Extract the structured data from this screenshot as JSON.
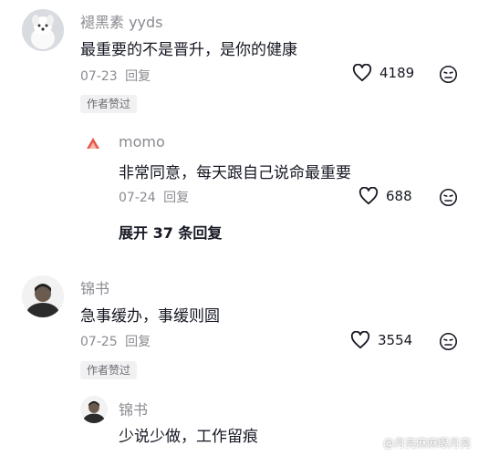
{
  "comments": [
    {
      "username": "褪黑素 yyds",
      "text": "最重要的不是晋升，是你的健康",
      "date": "07-23",
      "reply_label": "回复",
      "likes": "4189",
      "badge": "作者赞过",
      "replies": [
        {
          "username": "momo",
          "text": "非常同意，每天跟自己说命最重要",
          "date": "07-24",
          "reply_label": "回复",
          "likes": "688"
        }
      ],
      "expand_label": "展开 37 条回复"
    },
    {
      "username": "锦书",
      "text": "急事缓办，事缓则圆",
      "date": "07-25",
      "reply_label": "回复",
      "likes": "3554",
      "badge": "作者赞过",
      "replies": [
        {
          "username": "锦书",
          "text": "少说少做，工作留痕"
        }
      ]
    }
  ],
  "watermark": "@月亮麻麻眼月亮",
  "icons": {
    "like": "heart-icon",
    "dislike": "dislike-face-icon"
  }
}
